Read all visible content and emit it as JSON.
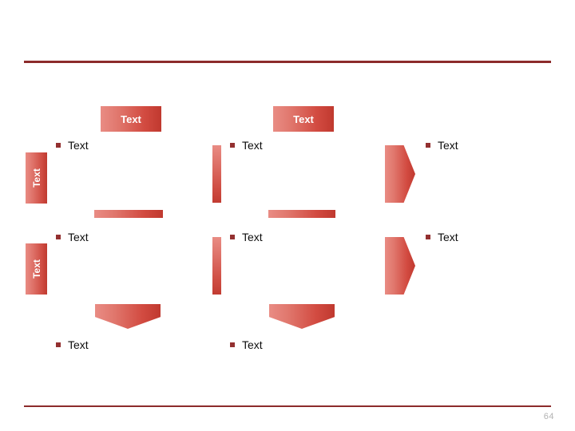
{
  "slide": {
    "page_number": "64",
    "accent_color": "#8c2b2b",
    "shape_gradient_light": "#e98c84",
    "shape_gradient_dark": "#c0392f",
    "bullet_color": "#933030",
    "page_number_color": "#b3b3b3"
  },
  "headers": [
    {
      "label": "Text"
    },
    {
      "label": "Text"
    }
  ],
  "row_labels": [
    {
      "label": "Text"
    },
    {
      "label": "Text"
    }
  ],
  "bullets": {
    "row1": [
      {
        "label": "Text"
      },
      {
        "label": "Text"
      },
      {
        "label": "Text"
      }
    ],
    "row2": [
      {
        "label": "Text"
      },
      {
        "label": "Text"
      },
      {
        "label": "Text"
      }
    ],
    "row3": [
      {
        "label": "Text"
      },
      {
        "label": "Text"
      }
    ]
  }
}
